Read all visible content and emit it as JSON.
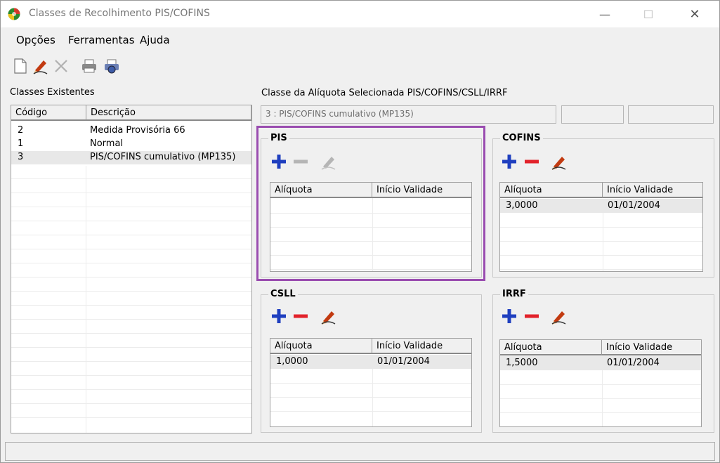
{
  "window": {
    "title": "Classes de Recolhimento PIS/COFINS",
    "controls": [
      "—",
      "☐",
      "✕"
    ]
  },
  "menu": [
    "Opções",
    "Ferramentas",
    "Ajuda"
  ],
  "toolbar": {
    "icons": [
      "new-document-icon",
      "edit-pencil-icon",
      "delete-x-icon",
      "print-icon",
      "print-preview-icon"
    ]
  },
  "left_panel": {
    "label": "Classes Existentes",
    "columns": [
      "Código",
      "Descrição"
    ],
    "rows": [
      {
        "code": "2",
        "desc": "Medida Provisória 66"
      },
      {
        "code": "1",
        "desc": "Normal"
      },
      {
        "code": "3",
        "desc": "PIS/COFINS cumulativo (MP135)"
      }
    ]
  },
  "right_panel": {
    "label": "Classe da Alíquota Selecionada PIS/COFINS/CSLL/IRRF",
    "selected_value": "3 : PIS/COFINS cumulativo (MP135)"
  },
  "groups": [
    {
      "title": "PIS",
      "columns": [
        "Alíquota",
        "Início Validade"
      ],
      "rows": [],
      "actions_enabled": false
    },
    {
      "title": "COFINS",
      "columns": [
        "Alíquota",
        "Início Validade"
      ],
      "rows": [
        {
          "rate": "3,0000",
          "start": "01/01/2004"
        }
      ],
      "actions_enabled": true
    },
    {
      "title": "CSLL",
      "columns": [
        "Alíquota",
        "Início Validade"
      ],
      "rows": [
        {
          "rate": "1,0000",
          "start": "01/01/2004"
        }
      ],
      "actions_enabled": true
    },
    {
      "title": "IRRF",
      "columns": [
        "Alíquota",
        "Início Validade"
      ],
      "rows": [
        {
          "rate": "1,5000",
          "start": "01/01/2004"
        }
      ],
      "actions_enabled": true
    }
  ],
  "colors": {
    "add": "#1f3fbf",
    "remove": "#e2222a",
    "disabled": "#b5b5b5",
    "highlight_frame": "#9a4db0",
    "selected_row": "#e8e8e8"
  }
}
